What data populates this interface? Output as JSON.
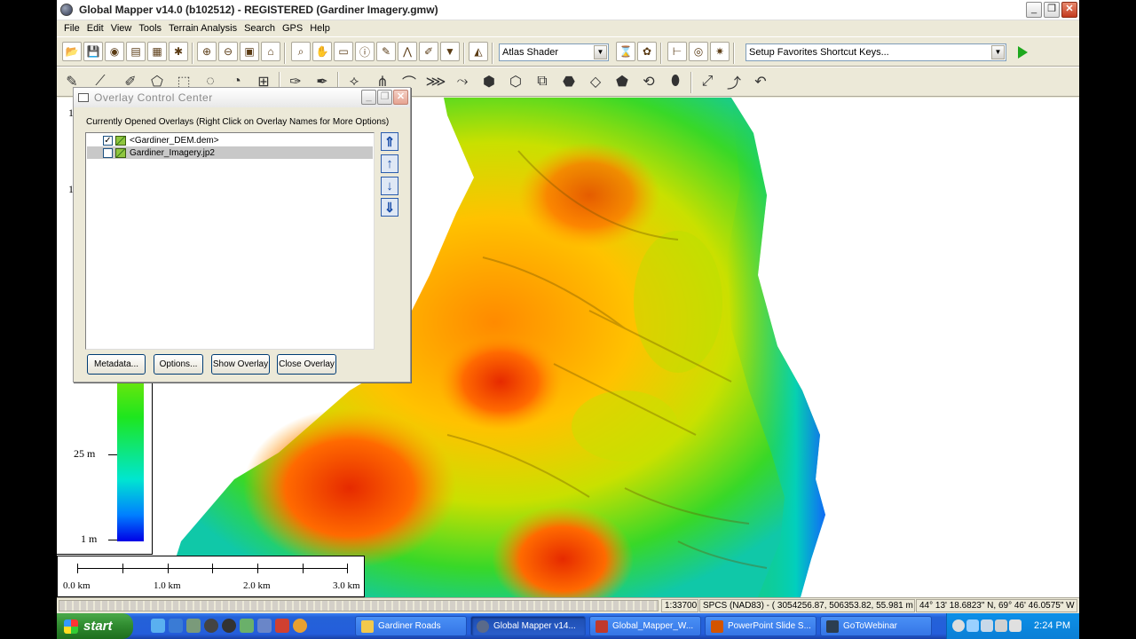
{
  "window": {
    "title": "Global Mapper v14.0 (b102512) - REGISTERED (Gardiner Imagery.gmw)",
    "min": "_",
    "max": "❐",
    "close": "✕"
  },
  "menu": [
    "File",
    "Edit",
    "View",
    "Tools",
    "Terrain Analysis",
    "Search",
    "GPS",
    "Help"
  ],
  "toolbar": {
    "shader_value": "Atlas Shader",
    "favorites_value": "Setup Favorites Shortcut Keys..."
  },
  "legend": {
    "labels": [
      {
        "text": "1",
        "pos": "top"
      },
      {
        "text": "1",
        "pos": "upper"
      },
      {
        "text": "25 m",
        "pos": "mid"
      },
      {
        "text": "1 m",
        "pos": "bottom"
      }
    ]
  },
  "scale": {
    "labels": [
      "0.0 km",
      "1.0 km",
      "2.0 km",
      "3.0 km"
    ]
  },
  "overlay_dialog": {
    "title": "Overlay Control Center",
    "list_caption": "Currently Opened Overlays (Right Click on Overlay Names for More Options)",
    "overlays": [
      {
        "name": "<Gardiner_DEM.dem>",
        "checked": true,
        "selected": false
      },
      {
        "name": "Gardiner_Imagery.jp2",
        "checked": false,
        "selected": true
      }
    ],
    "buttons": [
      "Metadata...",
      "Options...",
      "Show Overlay",
      "Close Overlay"
    ]
  },
  "status": {
    "scale": "1:33700",
    "projection": "SPCS (NAD83) - ( 3054256.87, 506353.82, 55.981 m )",
    "latlon": "44° 13' 18.6823\" N, 69° 46' 46.0575\" W"
  },
  "taskbar": {
    "start_label": "start",
    "tasks": [
      {
        "label": "Gardiner Roads",
        "active": false,
        "color": "#f2c94c"
      },
      {
        "label": "Global Mapper v14...",
        "active": true,
        "color": "#5a6a8a"
      },
      {
        "label": "Global_Mapper_W...",
        "active": false,
        "color": "#c0392b"
      },
      {
        "label": "PowerPoint Slide S...",
        "active": false,
        "color": "#d35400"
      },
      {
        "label": "GoToWebinar",
        "active": false,
        "color": "#2c3e50"
      }
    ],
    "clock": "2:24 PM"
  }
}
